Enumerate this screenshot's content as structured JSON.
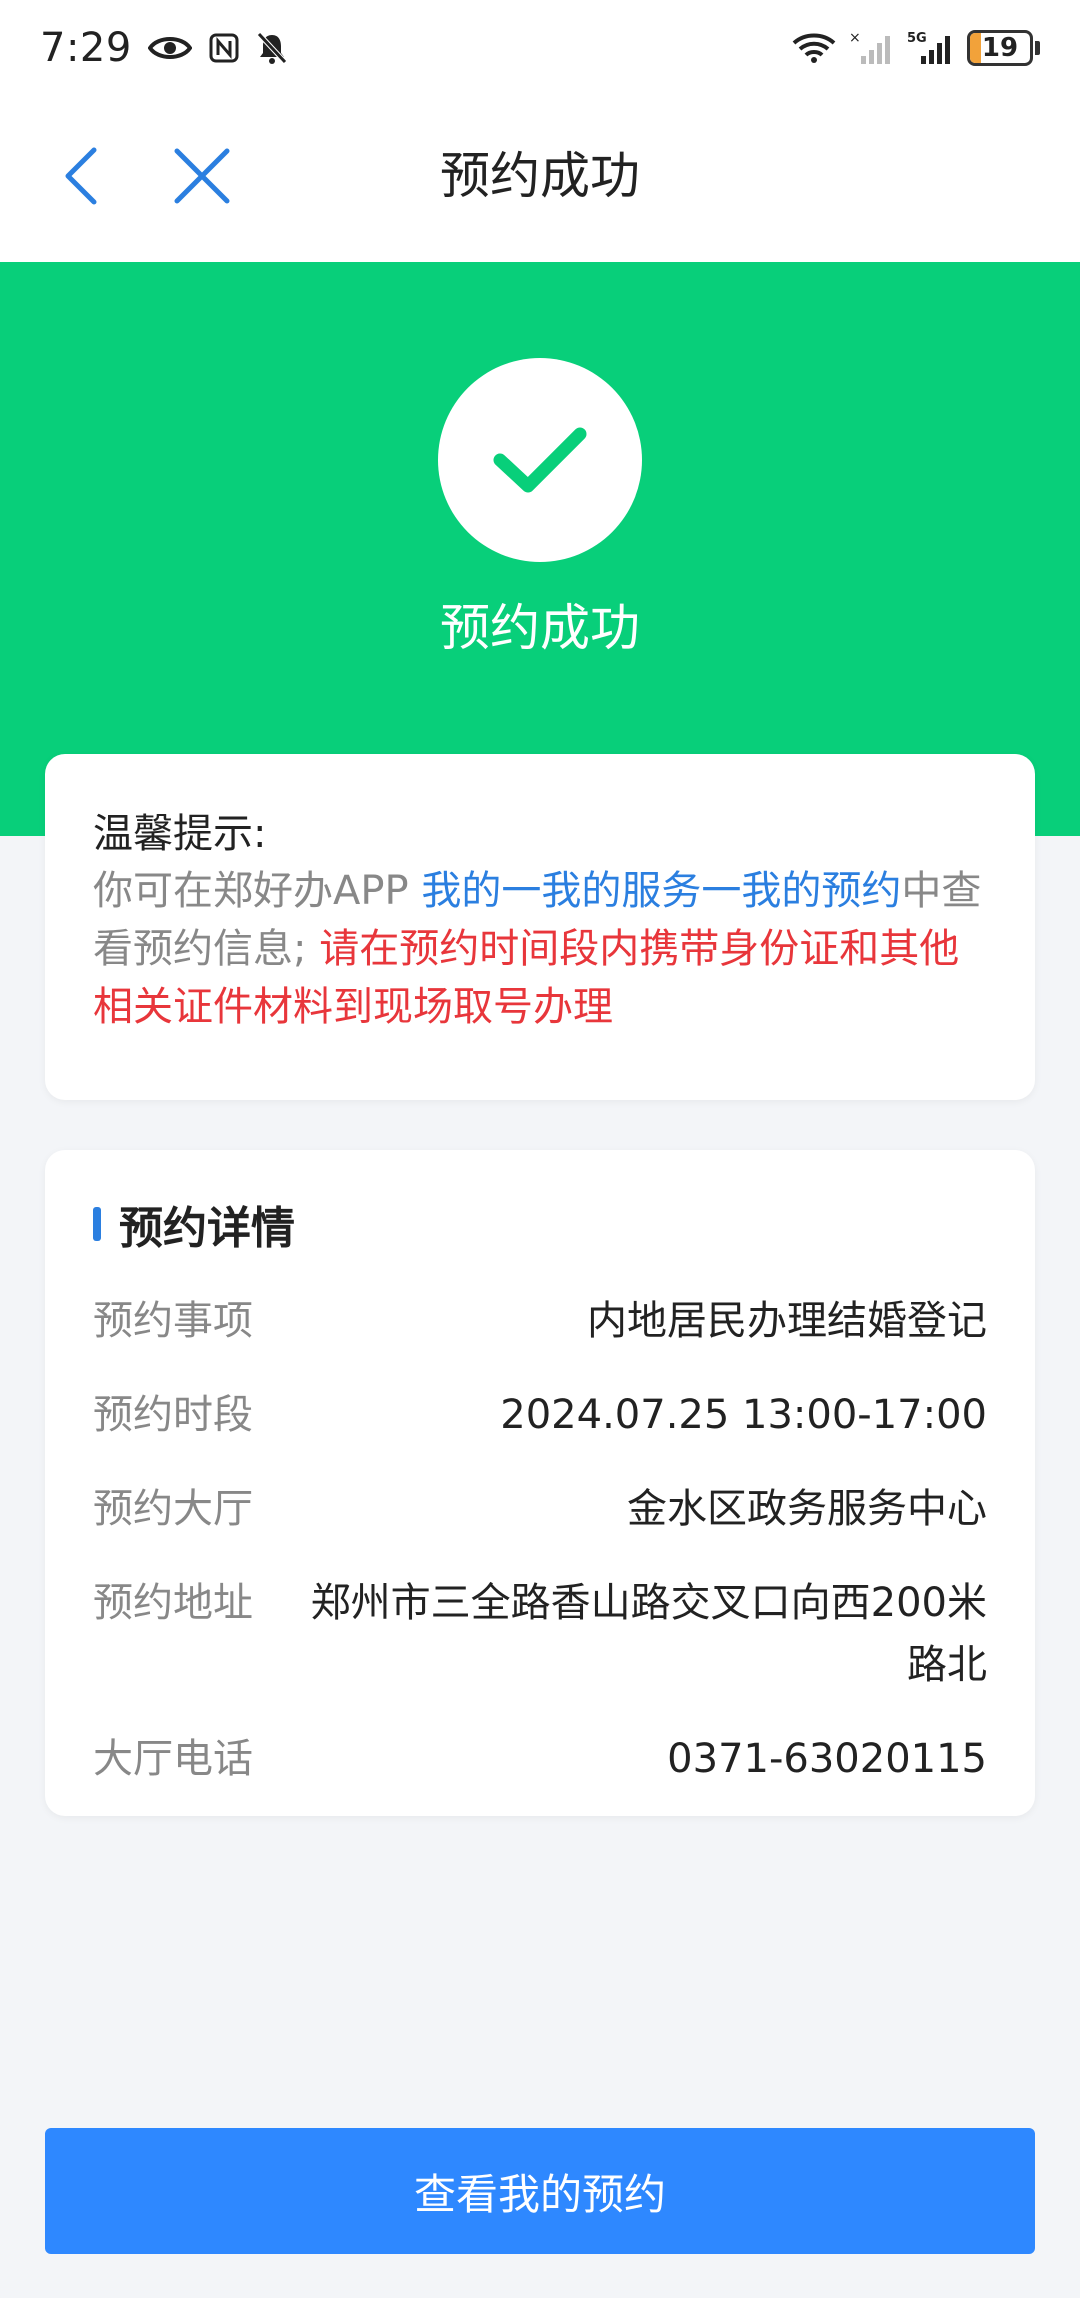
{
  "status_bar": {
    "time": "7:29",
    "battery_level": "19",
    "battery_fraction": 0.19,
    "network_label": "5G"
  },
  "nav": {
    "title": "预约成功"
  },
  "banner": {
    "title": "预约成功",
    "color": "#08cf7a"
  },
  "tips": {
    "title": "温馨提示:",
    "text_prefix": "你可在郑好办APP ",
    "link_text": "我的一我的服务一我的预约",
    "text_middle": "中查看预约信息; ",
    "warning_text": "请在预约时间段内携带身份证和其他相关证件材料到现场取号办理"
  },
  "detail": {
    "title": "预约详情",
    "rows": [
      {
        "label": "预约事项",
        "value": "内地居民办理结婚登记"
      },
      {
        "label": "预约时段",
        "value": "2024.07.25 13:00-17:00"
      },
      {
        "label": "预约大厅",
        "value": "金水区政务服务中心"
      },
      {
        "label": "预约地址",
        "value": "郑州市三全路香山路交叉口向西200米路北"
      },
      {
        "label": "大厅电话",
        "value": "0371-63020115"
      }
    ]
  },
  "action": {
    "button_label": "查看我的预约",
    "color": "#2e88ff"
  }
}
